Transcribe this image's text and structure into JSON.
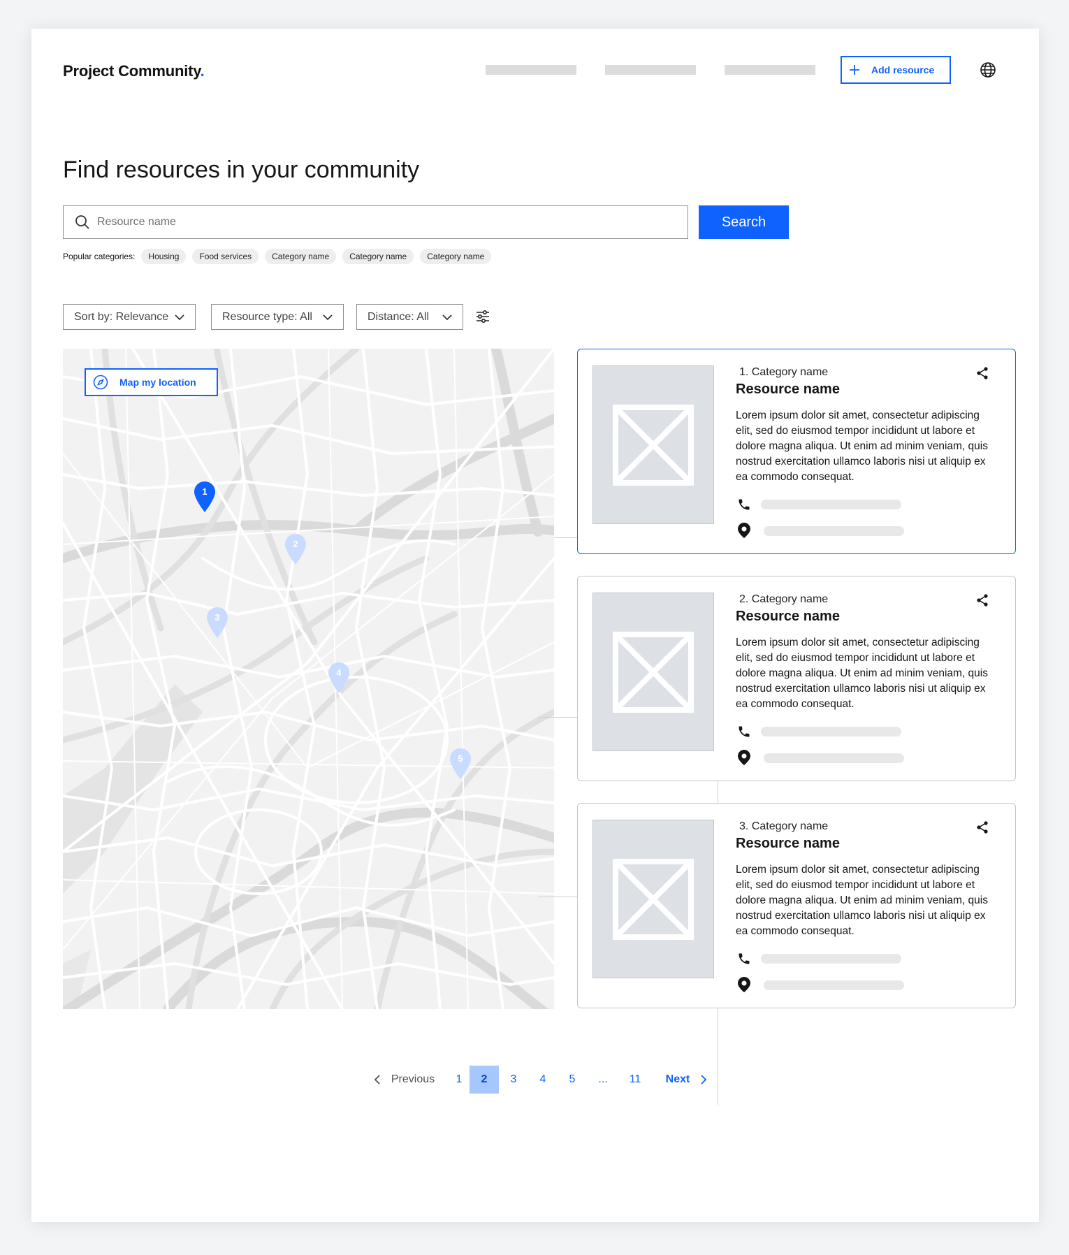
{
  "header": {
    "logo_text": "Project Community",
    "logo_dot": ".",
    "add_resource_label": "Add resource",
    "icons": [
      "plus-icon",
      "globe-icon"
    ]
  },
  "title": "Find resources in your community",
  "search": {
    "placeholder": "Resource name",
    "value": "",
    "button_label": "Search"
  },
  "popular": {
    "label": "Popular categories:",
    "chips": [
      "Housing",
      "Food services",
      "Category name",
      "Category name",
      "Category name"
    ]
  },
  "filters": {
    "sort_label": "Sort by: Relevance",
    "type_label": "Resource type: All",
    "distance_label": "Distance: All"
  },
  "map": {
    "button_label": "Map my location",
    "pins": [
      "1",
      "2",
      "3",
      "4",
      "5"
    ],
    "active_pin": "1"
  },
  "results": [
    {
      "category": "1.  Category name",
      "name": "Resource name",
      "description": "Lorem ipsum dolor sit amet, consectetur adipiscing elit, sed do eiusmod tempor incididunt ut labore et dolore magna aliqua. Ut enim ad minim veniam, quis nostrud exercitation ullamco laboris nisi ut aliquip ex ea commodo consequat.",
      "selected": true
    },
    {
      "category": "2.  Category name",
      "name": "Resource name",
      "description": "Lorem ipsum dolor sit amet, consectetur adipiscing elit, sed do eiusmod tempor incididunt ut labore et dolore magna aliqua. Ut enim ad minim veniam, quis nostrud exercitation ullamco laboris nisi ut aliquip ex ea commodo consequat.",
      "selected": false
    },
    {
      "category": "3.  Category name",
      "name": "Resource name",
      "description": "Lorem ipsum dolor sit amet, consectetur adipiscing elit, sed do eiusmod tempor incididunt ut labore et dolore magna aliqua. Ut enim ad minim veniam, quis nostrud exercitation ullamco laboris nisi ut aliquip ex ea commodo consequat.",
      "selected": false
    }
  ],
  "pagination": {
    "previous": "Previous",
    "next": "Next",
    "pages": [
      "1",
      "2",
      "3",
      "4",
      "5",
      "...",
      "11"
    ],
    "current": "2"
  },
  "colors": {
    "accent": "#0f62fe",
    "pin_inactive": "#c9dbff",
    "page_active_bg": "#a6c8ff",
    "placeholder_bar": "#dcdcdc"
  }
}
